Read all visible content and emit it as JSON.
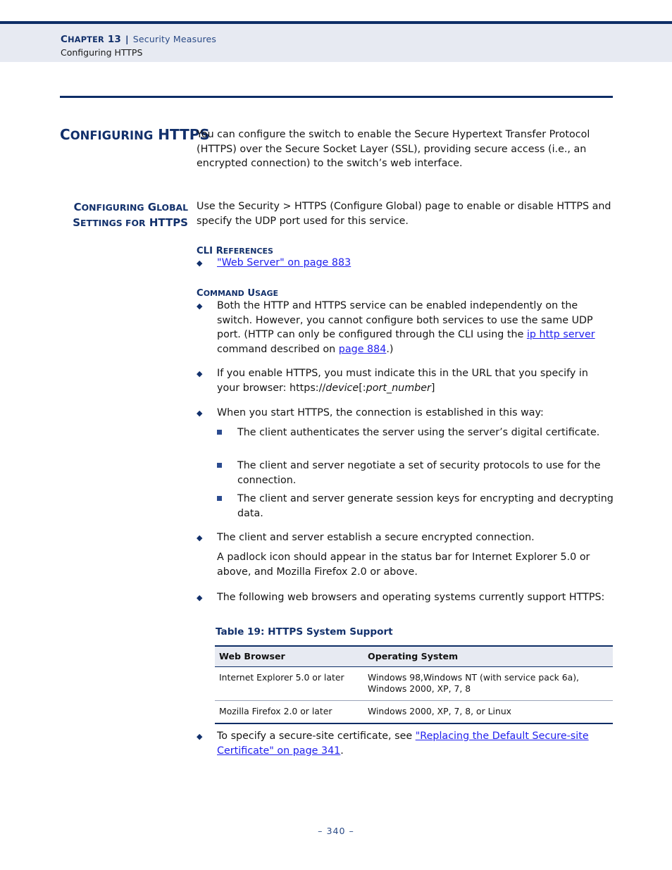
{
  "header": {
    "chapter_label_big": "C",
    "chapter_label_rest": "HAPTER",
    "chapter_number": "13",
    "separator": "|",
    "chapter_name": "Security Measures",
    "subtitle": "Configuring HTTPS"
  },
  "section": {
    "title_part1_big": "C",
    "title_part1_small": "ONFIGURING",
    "title_part2": "HTTPS",
    "intro": "You can configure the switch to enable the Secure Hypertext Transfer Protocol (HTTPS) over the Secure Socket Layer (SSL), providing secure access (i.e., an encrypted connection) to the switch’s web interface."
  },
  "subsection": {
    "sidehead_line1_big": "C",
    "sidehead_line1_mid": "ONFIGURING",
    "sidehead_line1_big2": "G",
    "sidehead_line1_end": "LOBAL",
    "sidehead_line2_big": "S",
    "sidehead_line2_mid": "ETTINGS FOR",
    "sidehead_line2_end": "HTTPS",
    "intro": "Use the Security > HTTPS (Configure Global) page to enable or disable HTTPS and specify the UDP port used for this service."
  },
  "cli_references": {
    "heading_big": "CLI R",
    "heading_small": "EFERENCES",
    "items": [
      {
        "link": "\"Web Server\" on page 883"
      }
    ]
  },
  "command_usage": {
    "heading_big": "C",
    "heading_mid": "OMMAND",
    "heading_big2": "U",
    "heading_end": "SAGE",
    "bullet1_a": "Both the HTTP and HTTPS service can be enabled independently on the switch. However, you cannot configure both services to use the same UDP port. (HTTP can only be configured through the CLI using the ",
    "bullet1_link1": "ip http server",
    "bullet1_b": " command described on ",
    "bullet1_link2": "page 884",
    "bullet1_c": ".)",
    "bullet2_a": "If you enable HTTPS, you must indicate this in the URL that you specify in your browser: https://",
    "bullet2_italic1": "device",
    "bullet2_b": "[:",
    "bullet2_italic2": "port_number",
    "bullet2_c": "]",
    "bullet3": "When you start HTTPS, the connection is established in this way:",
    "subbullets": [
      "The client authenticates the server using the server’s digital certificate.",
      "The client and server negotiate a set of security protocols to use for the connection.",
      "The client and server generate session keys for encrypting and decrypting data."
    ],
    "bullet4": "The client and server establish a secure encrypted connection.",
    "bullet4_cont": "A padlock icon should appear in the status bar for Internet Explorer 5.0 or above, and Mozilla Firefox 2.0 or above.",
    "bullet5": "The following web browsers and operating systems currently support HTTPS:",
    "bullet6_a": "To specify a secure-site certificate, see ",
    "bullet6_link": "\"Replacing the Default Secure-site Certificate\" on page 341",
    "bullet6_b": "."
  },
  "table": {
    "caption": "Table 19: HTTPS System Support",
    "columns": [
      "Web Browser",
      "Operating System"
    ],
    "rows": [
      {
        "browser": "Internet Explorer 5.0 or later",
        "os": "Windows 98,Windows NT (with service pack 6a), Windows 2000, XP, 7, 8"
      },
      {
        "browser": "Mozilla Firefox 2.0 or later",
        "os": "Windows 2000, XP, 7, 8, or Linux"
      }
    ]
  },
  "footer": {
    "page_number": "–   340   –"
  },
  "colors": {
    "navy": "#12306b",
    "rule": "#0d2d66",
    "band": "#e7eaf2",
    "link": "#2020ee"
  }
}
